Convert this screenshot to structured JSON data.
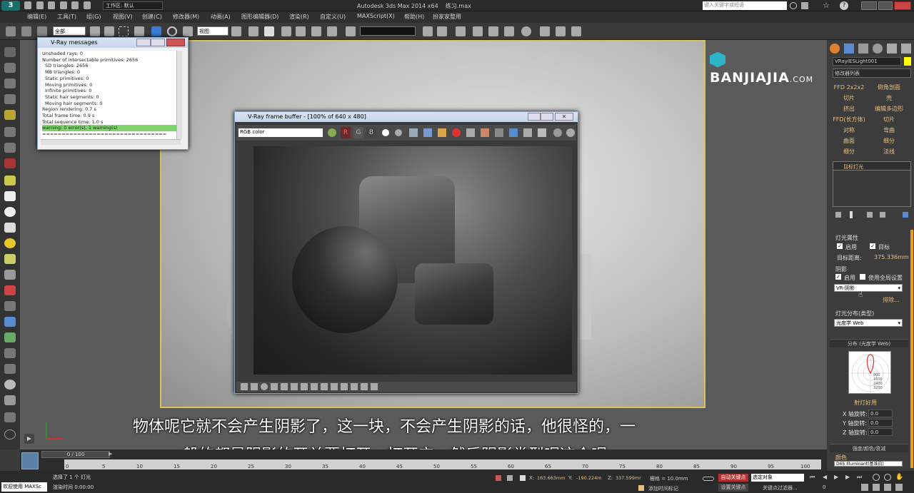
{
  "titlebar": {
    "workspace": "工作区: 默认",
    "app_title": "Autodesk 3ds Max  2014 x64",
    "file_name": "练习.max",
    "search_placeholder": "键入关键字或短语"
  },
  "menubar": [
    "编辑(E)",
    "工具(T)",
    "组(G)",
    "视图(V)",
    "创建(C)",
    "修改器(M)",
    "动画(A)",
    "图形编辑器(D)",
    "渲染(R)",
    "自定义(U)",
    "MAXScript(X)",
    "帮助(H)",
    "扮家家整用"
  ],
  "toolbar": {
    "selection_filter": "全部",
    "ref_coord": "视图",
    "named_selection": ""
  },
  "vray_messages": {
    "title": "V-Ray messages",
    "lines": [
      "Unshaded rays: 0",
      "Number of intersectable primitives: 2656",
      "  SD triangles: 2656",
      "  MB triangles: 0",
      "  Static primitives: 0",
      "  Moving primitives: 0",
      "  Infinite primitives: 0",
      "  Static hair segments: 0",
      "  Moving hair segments: 0",
      "Region rendering: 0.7 s",
      "Total frame time: 0.9 s",
      "Total sequence time: 1.0 s"
    ],
    "warning_line": "warning: 0 error(s), 1 warning(s)",
    "separator": "================================"
  },
  "frame_buffer": {
    "title": "V-Ray frame buffer - [100% of 640 x 480]",
    "channel": "RGB color",
    "channel_buttons": [
      "R",
      "G",
      "B"
    ]
  },
  "watermark": {
    "brand": "BANJIAJIA",
    "suffix": ".COM"
  },
  "right_panel": {
    "object_name": "VRayIESLight001",
    "modifier_list": "修改器列表",
    "modifier_buttons": [
      "FFD 2x2x2",
      "倒角剖面",
      "切片",
      "壳",
      "挤出",
      "编辑多边形",
      "FFD(长方体)",
      "切片",
      "对称",
      "弯曲",
      "曲面",
      "细分",
      "细分",
      "法线"
    ],
    "stack_item": "目标灯光",
    "light_props_title": "灯光属性",
    "enable_label": "启用",
    "target_label": "目标",
    "target_dist_label": "目标距离:",
    "target_dist_value": "375.336mm",
    "shadows_title": "阴影",
    "shadow_enable": "启用",
    "use_global": "使用全局设置",
    "shadow_type": "VR-阴影",
    "exclude_btn": "排除...",
    "distribution_title": "灯光分布(类型)",
    "distribution_type": "光度学 Web",
    "web_rollout": "分布 (光度学 Web)",
    "web_file_btn": "射灯好用",
    "x_rot_label": "X 轴旋转:",
    "y_rot_label": "Y 轴旋转:",
    "z_rot_label": "Z 轴旋转:",
    "x_rot": "0.0",
    "y_rot": "0.0",
    "z_rot": "0.0",
    "intensity_rollout": "强度/颜色/衰减",
    "color_label": "颜色",
    "color_value": "D65 Illuminant(基准白)",
    "web_graph_values": [
      "800",
      "1600",
      "2400",
      "3200"
    ]
  },
  "subtitles": {
    "line1": "物体呢它就不会产生阴影了，这一块，不会产生阴影的话，他很怪的，一",
    "line2": "般的都是阴影的开关要打开，打开它，然后阴影类型呢这个呢"
  },
  "timeline": {
    "frame_counter": "0 / 100",
    "ticks": [
      "0",
      "5",
      "10",
      "15",
      "20",
      "25",
      "30",
      "35",
      "40",
      "45",
      "50",
      "55",
      "60",
      "65",
      "70",
      "75",
      "80",
      "85",
      "90",
      "95",
      "100"
    ]
  },
  "statusbar": {
    "welcome": "欢迎使用 MAXSc",
    "status1": "选择了 1 个 灯光",
    "status2": "渲染时间 0:00:00",
    "x_label": "X:",
    "x_value": "163.663mm",
    "y_label": "Y:",
    "y_value": "-190.224m",
    "z_label": "Z:",
    "z_value": "337.599mr",
    "grid": "栅格 = 10.0mm",
    "add_time_tag": "添加时间标记",
    "auto_key": "自动关键点",
    "set_key": "设置关键点",
    "selected_object": "选定对象",
    "key_filters": "关键点过滤器...",
    "frame_field": "0"
  },
  "colors": {
    "accent_orange": "#e8c080",
    "warning_green": "#7fd36b",
    "watermark_teal": "#2bb5c8",
    "viewport_active": "#d7c35a",
    "status_key_red": "#b53030"
  }
}
